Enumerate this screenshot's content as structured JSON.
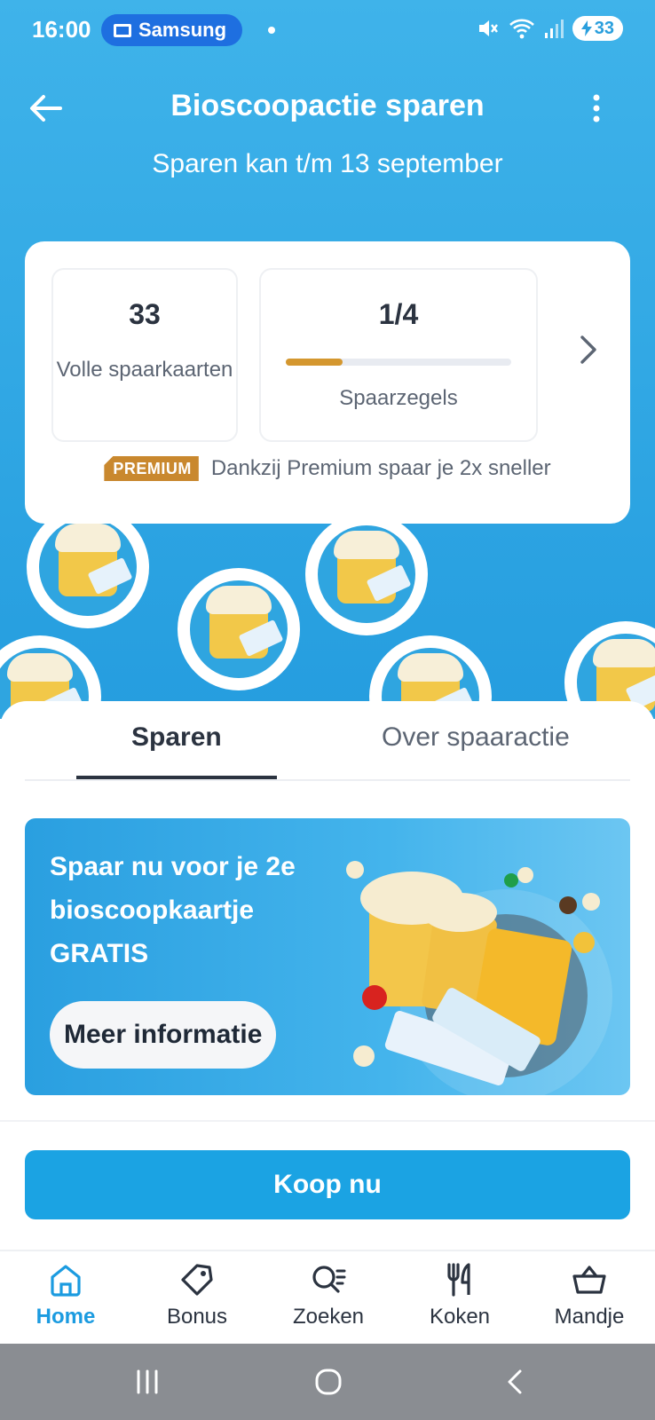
{
  "status_bar": {
    "time": "16:00",
    "cast_label": "Samsung",
    "battery": "33"
  },
  "header": {
    "title": "Bioscoopactie sparen",
    "subtitle": "Sparen kan t/m 13 september"
  },
  "progress_card": {
    "full_cards_value": "33",
    "full_cards_label": "Volle spaarkaarten",
    "stamps_value": "1/4",
    "stamps_progress": 0.25,
    "stamps_label": "Spaarzegels",
    "premium_badge": "PREMIUM",
    "premium_text": "Dankzij Premium spaar je 2x sneller"
  },
  "tokens": {
    "label": "Bioscoopzegel"
  },
  "tabs": [
    {
      "label": "Sparen",
      "active": true
    },
    {
      "label": "Over spaaractie",
      "active": false
    }
  ],
  "promo": {
    "text": "Spaar nu voor je 2e bioscoopkaartje GRATIS",
    "button_label": "Meer informatie"
  },
  "buy_button": {
    "label": "Koop nu"
  },
  "bottom_nav": [
    {
      "label": "Home",
      "icon": "home-icon",
      "active": true
    },
    {
      "label": "Bonus",
      "icon": "tag-icon",
      "active": false
    },
    {
      "label": "Zoeken",
      "icon": "search-icon",
      "active": false
    },
    {
      "label": "Koken",
      "icon": "cutlery-icon",
      "active": false
    },
    {
      "label": "Mandje",
      "icon": "basket-icon",
      "active": false
    }
  ],
  "colors": {
    "brand_blue": "#1ba3e3",
    "hero_blue": "#2fa6e3",
    "premium_gold": "#c9882e",
    "progress_fill": "#d4972f"
  }
}
